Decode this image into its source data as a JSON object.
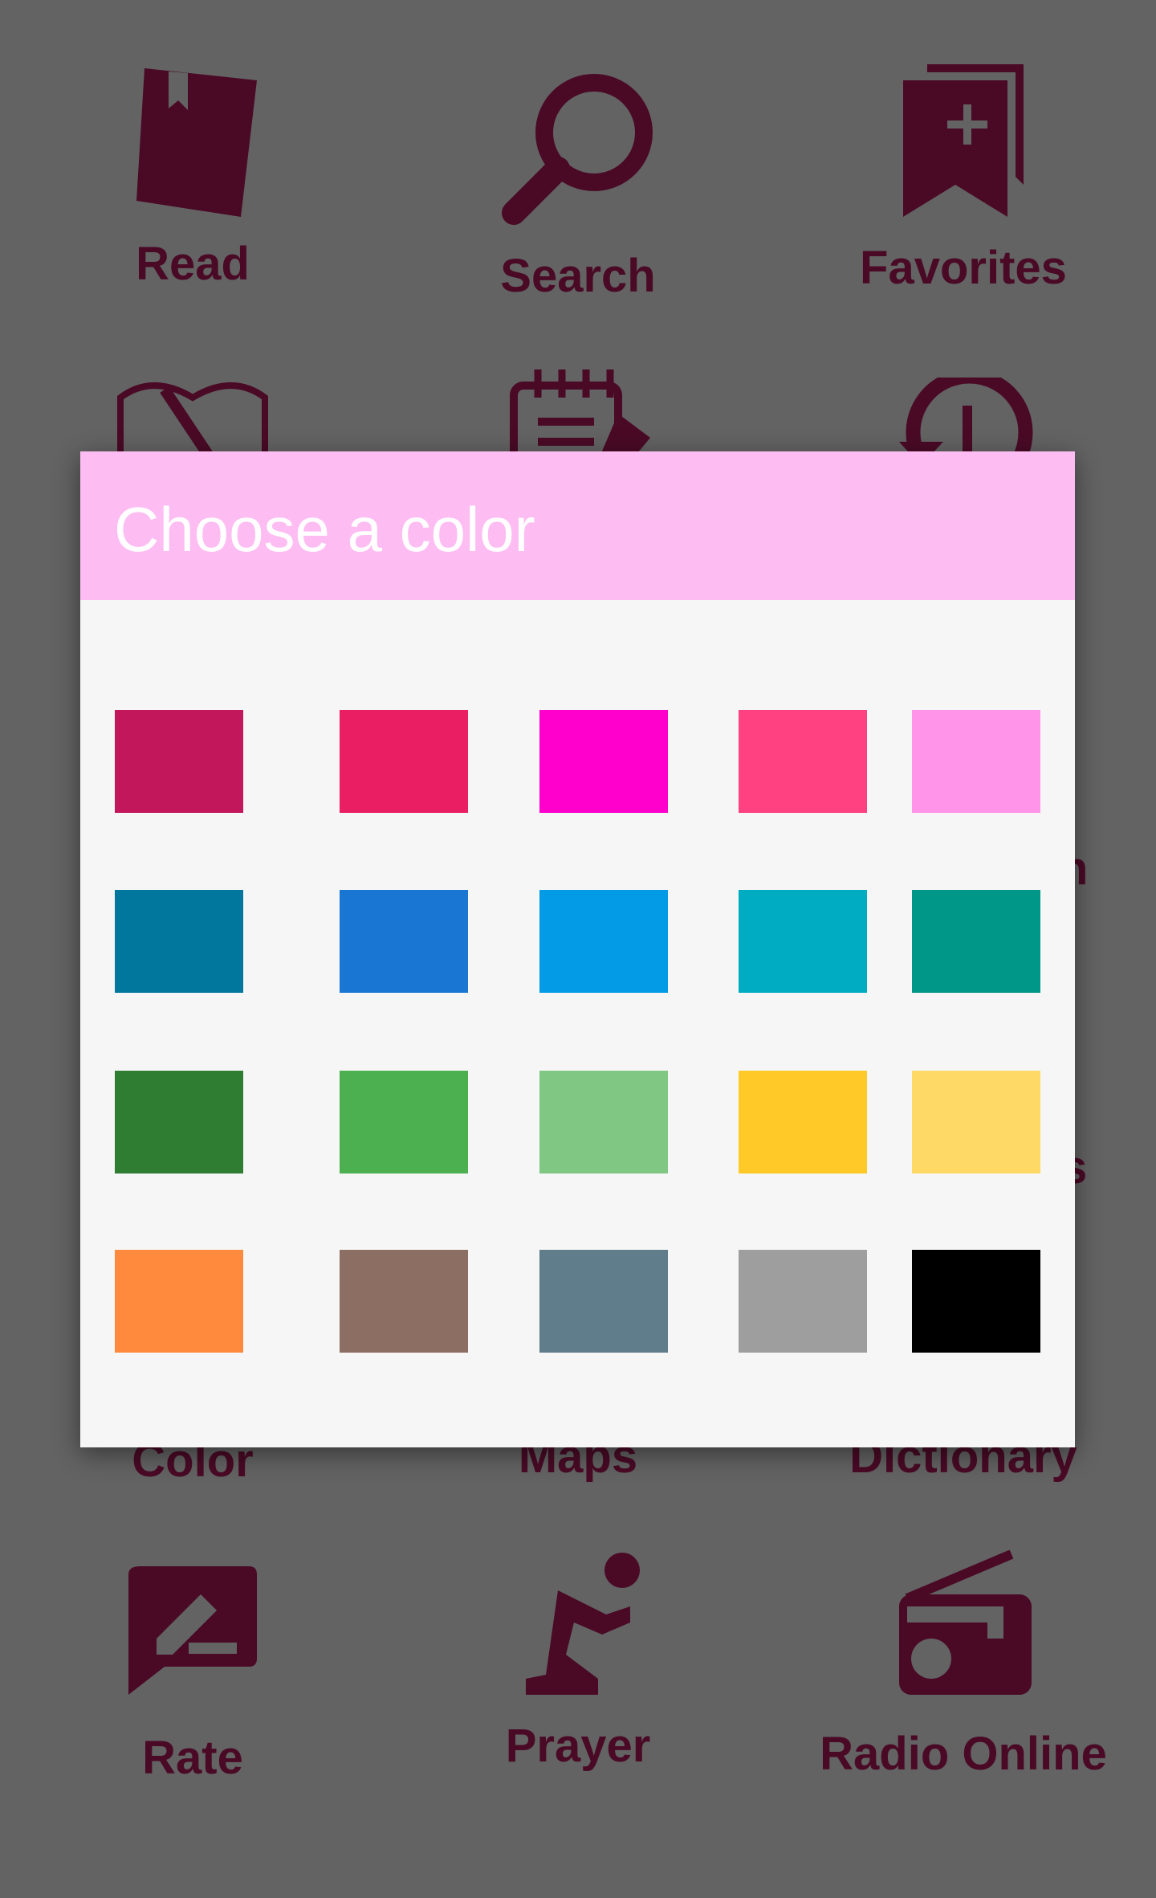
{
  "menu": {
    "items": [
      {
        "label": "Read",
        "icon": "book-icon"
      },
      {
        "label": "Search",
        "icon": "magnifier-icon"
      },
      {
        "label": "Favorites",
        "icon": "bookmark-plus-icon"
      },
      {
        "label": "",
        "icon": "open-book-pencil-icon"
      },
      {
        "label": "",
        "icon": "notepad-pencil-icon"
      },
      {
        "label": "",
        "icon": "history-clock-icon"
      },
      {
        "label": "Color",
        "icon": ""
      },
      {
        "label": "Maps",
        "icon": ""
      },
      {
        "label": "Dictionary",
        "icon": ""
      },
      {
        "label": "Rate",
        "icon": "rate-edit-icon"
      },
      {
        "label": "Prayer",
        "icon": "prayer-icon"
      },
      {
        "label": "Radio Online",
        "icon": "radio-icon"
      }
    ],
    "partial_labels": [
      "n",
      "s"
    ],
    "icon_color": "#4a0a26",
    "overlay_color": "#636363"
  },
  "dialog": {
    "title": "Choose a color",
    "header_color": "#fdbdf2",
    "swatches": [
      "#c2185b",
      "#e91e63",
      "#ff00cc",
      "#ff4081",
      "#ff94e8",
      "#01779e",
      "#1976d2",
      "#039be5",
      "#00acc1",
      "#009688",
      "#2e7d32",
      "#4caf50",
      "#81c784",
      "#ffca28",
      "#ffd966",
      "#ff8a3d",
      "#8d6e63",
      "#607d8b",
      "#9e9e9e",
      "#000000"
    ]
  }
}
